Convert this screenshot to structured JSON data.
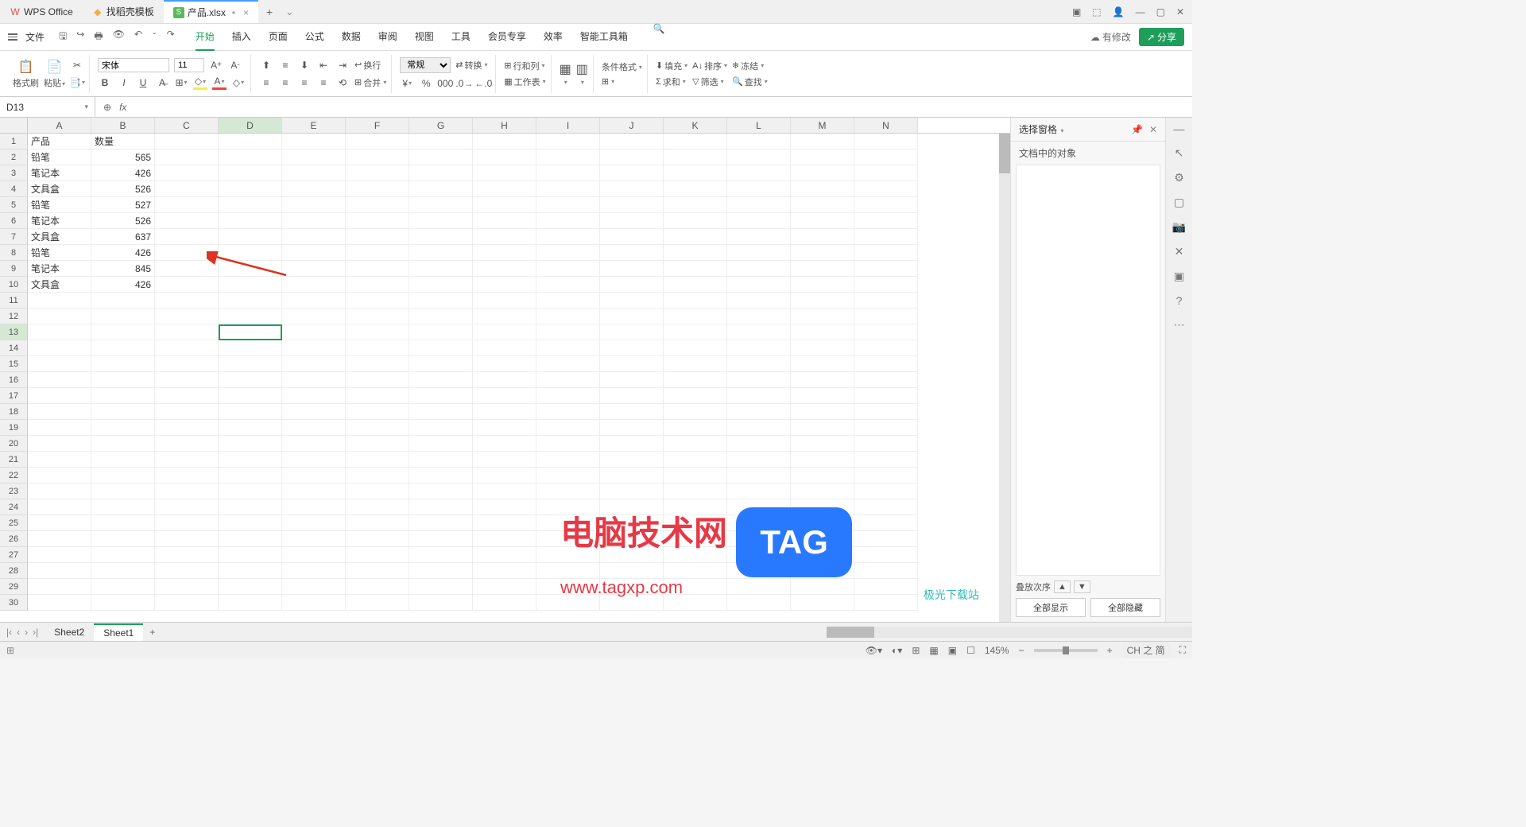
{
  "titlebar": {
    "tabs": [
      {
        "icon": "W",
        "label": "WPS Office"
      },
      {
        "icon": "D",
        "label": "找稻壳模板"
      },
      {
        "icon": "S",
        "label": "产品.xlsx",
        "active": true,
        "dirty": true
      }
    ]
  },
  "menubar": {
    "file": "文件",
    "tabs": [
      "开始",
      "插入",
      "页面",
      "公式",
      "数据",
      "审阅",
      "视图",
      "工具",
      "会员专享",
      "效率",
      "智能工具箱"
    ],
    "active_tab": "开始",
    "pending": "有修改",
    "share": "分享"
  },
  "ribbon": {
    "format_painter": "格式刷",
    "paste": "粘贴",
    "font_name": "宋体",
    "font_size": "11",
    "wrap": "换行",
    "number_fmt": "常规",
    "convert": "转换",
    "rowcol": "行和列",
    "worksheet": "工作表",
    "cond_fmt": "条件格式",
    "fill": "填充",
    "sort": "排序",
    "freeze": "冻结",
    "sum": "求和",
    "filter": "筛选",
    "find": "查找",
    "merge": "合并"
  },
  "formula": {
    "namebox": "D13",
    "fx": "fx"
  },
  "columns": [
    "A",
    "B",
    "C",
    "D",
    "E",
    "F",
    "G",
    "H",
    "I",
    "J",
    "K",
    "L",
    "M",
    "N"
  ],
  "selected_col": "D",
  "selected_row": 13,
  "row_count": 30,
  "data_rows": [
    {
      "a": "产品",
      "b": "数量"
    },
    {
      "a": "铅笔",
      "b": "565"
    },
    {
      "a": "笔记本",
      "b": "426"
    },
    {
      "a": "文具盒",
      "b": "526"
    },
    {
      "a": "铅笔",
      "b": "527"
    },
    {
      "a": "笔记本",
      "b": "526"
    },
    {
      "a": "文具盒",
      "b": "637"
    },
    {
      "a": "铅笔",
      "b": "426"
    },
    {
      "a": "笔记本",
      "b": "845"
    },
    {
      "a": "文具盒",
      "b": "426"
    }
  ],
  "right_panel": {
    "title": "选择窗格",
    "subtitle": "文档中的对象",
    "stack": "叠放次序",
    "show_all": "全部显示",
    "hide_all": "全部隐藏"
  },
  "sheets": {
    "tabs": [
      "Sheet2",
      "Sheet1"
    ],
    "active": "Sheet1"
  },
  "status": {
    "zoom": "145%",
    "ime": "CH 之 简"
  },
  "watermark": {
    "text": "电脑技术网",
    "url": "www.tagxp.com",
    "tag": "TAG",
    "jg": "极光下载站"
  }
}
